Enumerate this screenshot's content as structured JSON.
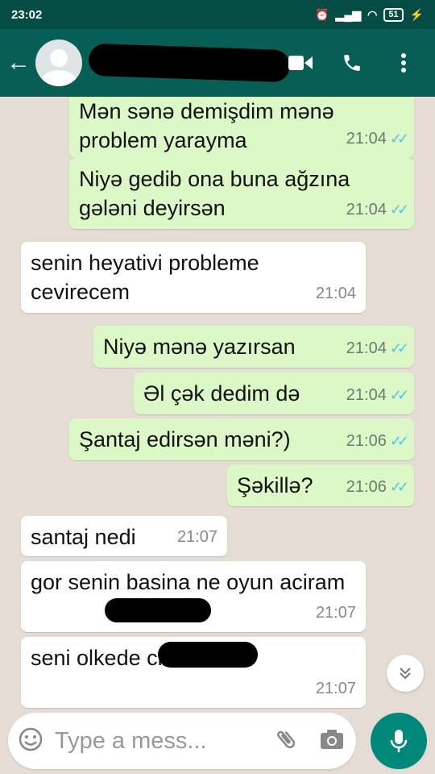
{
  "status_bar": {
    "time": "23:02",
    "battery": "51"
  },
  "header": {
    "back_icon": "back-arrow-icon",
    "actions": [
      "video-call-icon",
      "voice-call-icon",
      "more-options-icon"
    ]
  },
  "messages": [
    {
      "text": "Mən sənə demişdim mənə problem yarayma",
      "time": "21:04",
      "direction": "out",
      "read": true
    },
    {
      "text": "Niyə gedib ona buna ağzına gələni deyirsən",
      "time": "21:04",
      "direction": "out",
      "read": true
    },
    {
      "text": "senin heyativi probleme cevirecem",
      "time": "21:04",
      "direction": "in"
    },
    {
      "text": "Niyə mənə yazırsan",
      "time": "21:04",
      "direction": "out",
      "read": true
    },
    {
      "text": "Əl çək dedim də",
      "time": "21:04",
      "direction": "out",
      "read": true
    },
    {
      "text": "Şantaj edirsən məni?)",
      "time": "21:06",
      "direction": "out",
      "read": true
    },
    {
      "text": "Şəkillə?",
      "time": "21:06",
      "direction": "out",
      "read": true
    },
    {
      "text": "santaj nedi",
      "time": "21:07",
      "direction": "in"
    },
    {
      "text": "gor senin basina ne oyun aciram",
      "time": "21:07",
      "direction": "in"
    },
    {
      "text": "seni olkede cixaracam",
      "time": "21:07",
      "direction": "in"
    }
  ],
  "composer": {
    "placeholder": "Type a mess..."
  },
  "colors": {
    "header": "#075e54",
    "statusbar": "#054d44",
    "outgoing": "#dcf8c6",
    "incoming": "#ffffff",
    "read_ticks": "#4fc3f7",
    "mic": "#00897b"
  }
}
